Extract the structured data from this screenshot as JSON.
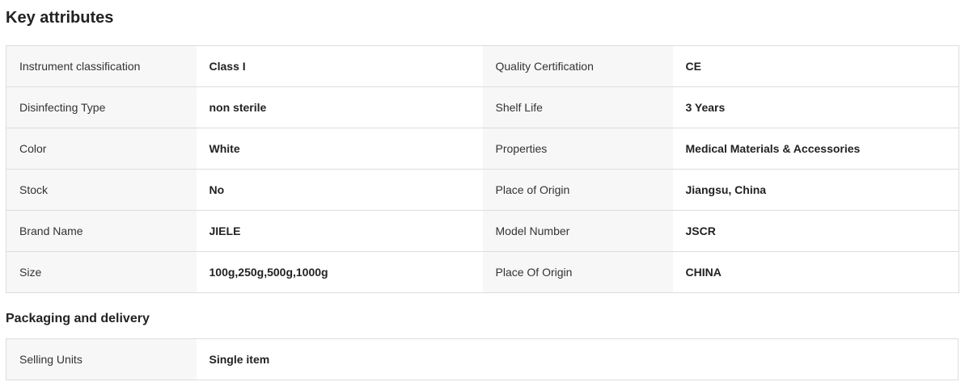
{
  "key_attributes": {
    "title": "Key attributes",
    "rows": [
      {
        "k1": "Instrument classification",
        "v1": "Class I",
        "k2": "Quality Certification",
        "v2": "CE"
      },
      {
        "k1": "Disinfecting Type",
        "v1": "non sterile",
        "k2": "Shelf Life",
        "v2": "3 Years"
      },
      {
        "k1": "Color",
        "v1": "White",
        "k2": "Properties",
        "v2": "Medical Materials & Accessories"
      },
      {
        "k1": "Stock",
        "v1": "No",
        "k2": "Place of Origin",
        "v2": "Jiangsu, China"
      },
      {
        "k1": "Brand Name",
        "v1": "JIELE",
        "k2": "Model Number",
        "v2": "JSCR"
      },
      {
        "k1": "Size",
        "v1": "100g,250g,500g,1000g",
        "k2": "Place Of Origin",
        "v2": "CHINA"
      }
    ]
  },
  "packaging": {
    "title": "Packaging and delivery",
    "rows": [
      {
        "k": "Selling Units",
        "v": "Single item"
      }
    ]
  }
}
